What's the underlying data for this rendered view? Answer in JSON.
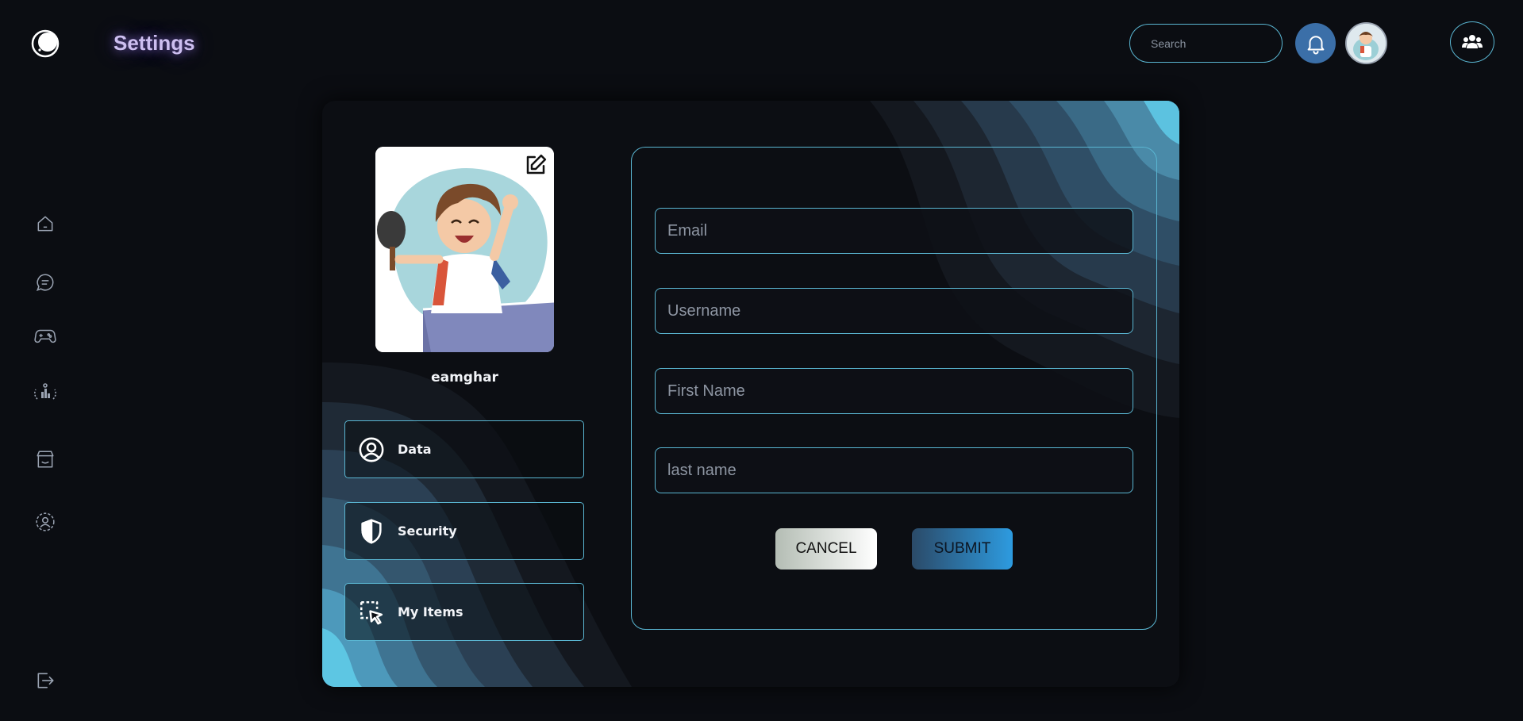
{
  "header": {
    "title": "Settings",
    "search_placeholder": "Search"
  },
  "sidebar": {
    "items": [
      {
        "name": "home-icon"
      },
      {
        "name": "chat-icon"
      },
      {
        "name": "gamepad-icon"
      },
      {
        "name": "leaderboard-icon"
      },
      {
        "name": "store-icon"
      },
      {
        "name": "profile-icon"
      },
      {
        "name": "logout-icon"
      }
    ]
  },
  "profile": {
    "username": "eamghar"
  },
  "menu": [
    {
      "label": "Data",
      "icon": "user-circle-icon"
    },
    {
      "label": "Security",
      "icon": "shield-icon"
    },
    {
      "label": "My Items",
      "icon": "cursor-select-icon"
    }
  ],
  "form": {
    "email_placeholder": "Email",
    "username_placeholder": "Username",
    "first_name_placeholder": "First Name",
    "last_name_placeholder": "last name",
    "cancel_label": "CANCEL",
    "submit_label": "SUBMIT"
  },
  "colors": {
    "accent": "#5ab6d2",
    "background": "#0b0d12",
    "bell": "#3b6fa8",
    "title_glow": "#cdbff0"
  }
}
